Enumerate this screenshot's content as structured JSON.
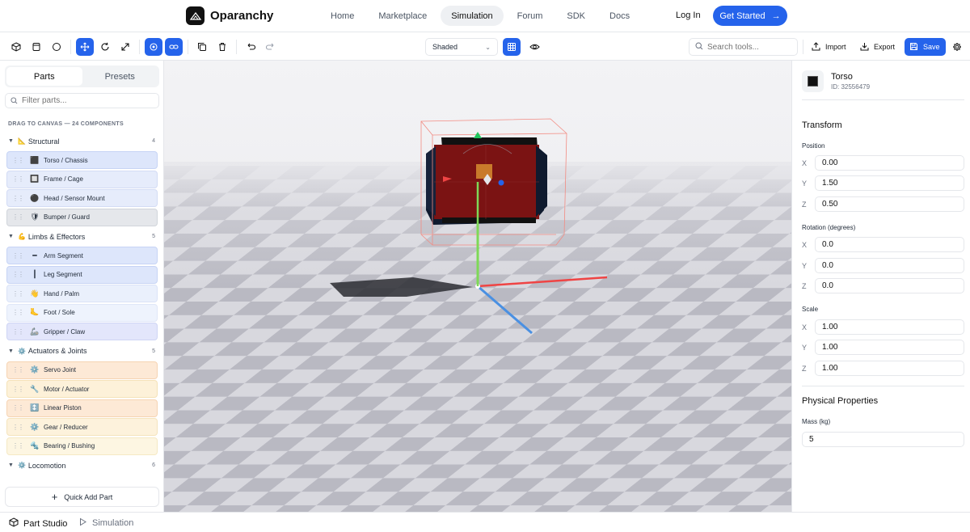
{
  "app": {
    "brand": "Oparanchy"
  },
  "nav": {
    "links": [
      "Home",
      "Marketplace",
      "Simulation",
      "Forum",
      "SDK",
      "Docs"
    ],
    "active": "Simulation",
    "login": "Log In",
    "get_started": "Get Started"
  },
  "toolbar": {
    "view_mode": "Shaded",
    "search_placeholder": "Search tools...",
    "import": "Import",
    "export": "Export",
    "save": "Save"
  },
  "sidebar": {
    "tabs": [
      "Parts",
      "Presets"
    ],
    "active_tab": "Parts",
    "filter_placeholder": "Filter parts...",
    "drag_label": "DRAG TO CANVAS — 24 COMPONENTS",
    "categories": [
      {
        "name": "Structural",
        "count": "4",
        "items": [
          "Torso / Chassis",
          "Frame / Cage",
          "Head / Sensor Mount",
          "Bumper / Guard"
        ]
      },
      {
        "name": "Limbs & Effectors",
        "count": "5",
        "items": [
          "Arm Segment",
          "Leg Segment",
          "Hand / Palm",
          "Foot / Sole",
          "Gripper / Claw"
        ]
      },
      {
        "name": "Actuators & Joints",
        "count": "5",
        "items": [
          "Servo Joint",
          "Motor / Actuator",
          "Linear Piston",
          "Gear / Reducer",
          "Bearing / Bushing"
        ]
      },
      {
        "name": "Locomotion",
        "count": "6",
        "items": []
      }
    ],
    "quick_add": "Quick Add Part"
  },
  "properties": {
    "part_name": "Torso",
    "part_id": "ID: 32556479",
    "transform_title": "Transform",
    "position_label": "Position",
    "position": {
      "x": "0.00",
      "y": "1.50",
      "z": "0.50"
    },
    "rotation_label": "Rotation (degrees)",
    "rotation": {
      "x": "0.0",
      "y": "0.0",
      "z": "0.0"
    },
    "scale_label": "Scale",
    "scale": {
      "x": "1.00",
      "y": "1.00",
      "z": "1.00"
    },
    "physical_title": "Physical Properties",
    "mass_label": "Mass (kg)",
    "mass": "5",
    "axes": [
      "X",
      "Y",
      "Z"
    ]
  },
  "bottom": {
    "tabs": [
      "Part Studio",
      "Simulation"
    ]
  },
  "colors": {
    "accent": "#2563eb",
    "part_red": "#7f1212",
    "axis_x": "#ef4444",
    "axis_y": "#22c55e",
    "axis_z": "#3b82f6"
  }
}
